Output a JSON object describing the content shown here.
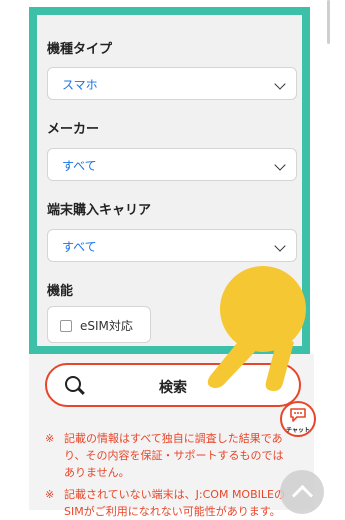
{
  "filters": {
    "model_type": {
      "label": "機種タイプ",
      "value": "スマホ"
    },
    "maker": {
      "label": "メーカー",
      "value": "すべて"
    },
    "carrier": {
      "label": "端末購入キャリア",
      "value": "すべて"
    },
    "features": {
      "label": "機能",
      "option": "eSIM対応",
      "checked": false
    }
  },
  "search": {
    "label": "検索"
  },
  "chat": {
    "label": "チャット"
  },
  "notes": [
    {
      "mark": "※",
      "text": "記載の情報はすべて独自に調査した結果であり、その内容を保証・サポートするものではありません。"
    },
    {
      "mark": "※",
      "text": "記載されていない端末は、J:COM MOBILEのSIMがご利用になれない可能性があります。"
    }
  ],
  "colors": {
    "highlight": "#3cc0a7",
    "accent": "#e8462a",
    "link": "#1a73e8",
    "gesture": "#f5c732"
  },
  "icons": {
    "search": "magnifier",
    "chevron": "chevron-down",
    "chat": "speech-bubble",
    "scroll_top": "chevron-up",
    "gesture": "pointing-hand"
  }
}
